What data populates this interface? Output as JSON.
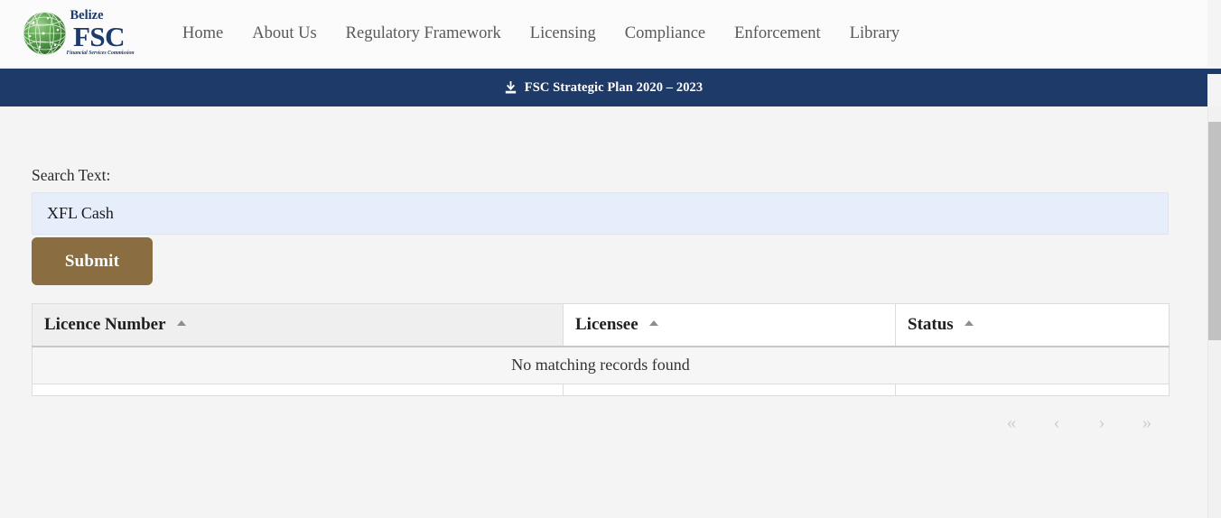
{
  "header": {
    "logo": {
      "brand_top": "Belize",
      "brand_main": "FSC",
      "brand_sub": "Financial Services Commission",
      "navy": "#1e3a68",
      "green": "#4f9a4a"
    },
    "nav_items": [
      {
        "label": "Home"
      },
      {
        "label": "About Us"
      },
      {
        "label": "Regulatory Framework"
      },
      {
        "label": "Licensing"
      },
      {
        "label": "Compliance"
      },
      {
        "label": "Enforcement"
      },
      {
        "label": "Library"
      }
    ]
  },
  "banner": {
    "icon": "download-icon",
    "label": "FSC Strategic Plan 2020 – 2023",
    "background": "#1e3a68",
    "text_color": "#ffffff"
  },
  "search": {
    "label": "Search Text:",
    "value": "XFL Cash",
    "placeholder": "",
    "submit_label": "Submit",
    "submit_color": "#8a6d41",
    "input_background": "#e6edfb"
  },
  "table": {
    "columns": [
      {
        "label": "Licence Number",
        "sort": "asc",
        "sorted": true
      },
      {
        "label": "Licensee",
        "sort": "asc",
        "sorted": false
      },
      {
        "label": "Status",
        "sort": "asc",
        "sorted": false
      }
    ],
    "rows": [],
    "empty_message": "No matching records found"
  },
  "pagination": {
    "first_label": "«",
    "prev_label": "‹",
    "next_label": "›",
    "last_label": "»"
  },
  "scrollbar": {
    "thumb_color": "#c1c1c1",
    "track_color": "#f1f1f1"
  }
}
